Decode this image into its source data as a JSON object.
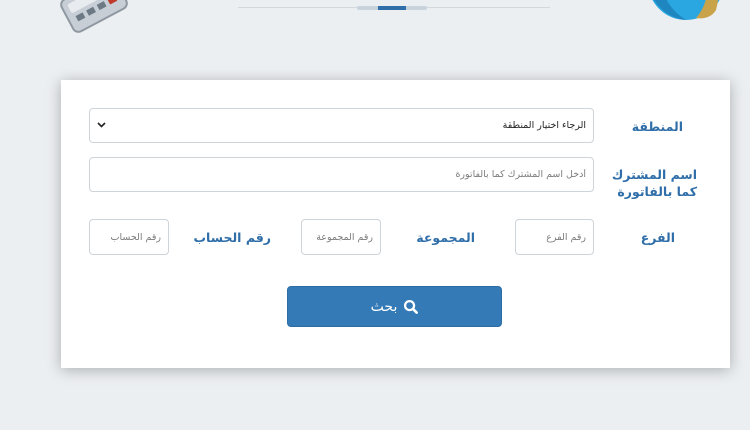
{
  "form": {
    "region_label": "المنطقة",
    "region_selected": "الرجاء اختيار المنطقة",
    "subscriber_label_line1": "اسم المشترك",
    "subscriber_label_line2": "كما بالفاتورة",
    "subscriber_placeholder": "أدخل اسم المشترك كما بالفاتورة",
    "branch_label": "الفرع",
    "branch_placeholder": "رقم الفرع",
    "group_label": "المجموعة",
    "group_placeholder": "رقم المجموعة",
    "account_label": "رقم الحساب",
    "account_placeholder": "رقم الحساب",
    "search_button_label": "بحث"
  },
  "icons": {
    "search": "search-icon",
    "dropdown": "chevron-down-icon",
    "decor_left": "card-reader-icon",
    "decor_right": "globe-icon"
  },
  "colors": {
    "accent": "#2f6ea8",
    "button": "#337ab7",
    "background": "#eceff2"
  }
}
